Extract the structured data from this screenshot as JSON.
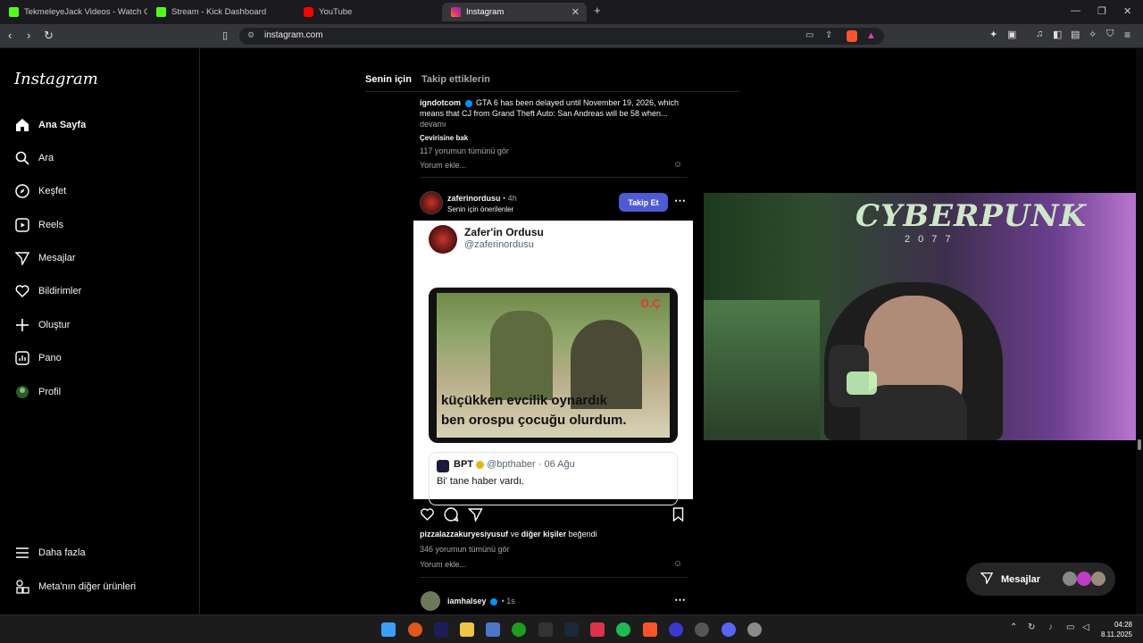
{
  "browser": {
    "tabs": [
      {
        "label": "TekmeleyeJack Videos - Watch On-D",
        "color": "#53fc18"
      },
      {
        "label": "Stream - Kick Dashboard",
        "color": "#53fc18"
      },
      {
        "label": "YouTube",
        "color": "#ff0000"
      },
      {
        "label": "Instagram",
        "color": "#e1306c"
      }
    ],
    "new_tab": "+",
    "url": "instagram.com"
  },
  "sidebar": {
    "logo": "Instagram",
    "items": [
      {
        "label": "Ana Sayfa",
        "icon": "home-icon"
      },
      {
        "label": "Ara",
        "icon": "search-icon"
      },
      {
        "label": "Keşfet",
        "icon": "compass-icon"
      },
      {
        "label": "Reels",
        "icon": "reels-icon"
      },
      {
        "label": "Mesajlar",
        "icon": "send-icon"
      },
      {
        "label": "Bildirimler",
        "icon": "heart-icon"
      },
      {
        "label": "Oluştur",
        "icon": "plus-icon"
      },
      {
        "label": "Pano",
        "icon": "chart-icon"
      },
      {
        "label": "Profil",
        "icon": "avatar-icon"
      }
    ],
    "more": "Daha fazla",
    "meta": "Meta'nın diğer ürünleri"
  },
  "feed": {
    "tabs": [
      "Senin için",
      "Takip ettiklerin"
    ],
    "prev_post": {
      "username": "igndotcom",
      "caption_line1": "GTA 6 has been delayed until November 19, 2026, which",
      "caption_line2": "means that CJ from Grand Theft Auto: San Andreas will be 58 when...",
      "more": "devamı",
      "translate": "Çevirisine bak",
      "comments": "117 yorumun tümünü gör",
      "add_comment": "Yorum ekle..."
    },
    "post": {
      "username": "zaferinordusu",
      "time": "• 4h",
      "suggested": "Senin için önerilenler",
      "follow": "Takip Et",
      "card_name": "Zafer'in Ordusu",
      "card_handle": "@zaferinordusu",
      "meme_line1": "küçükken evcilik oynardık",
      "meme_line2": "ben orospu çocuğu olurdum.",
      "meme_badge": "D.Ç",
      "quote_name": "BPT",
      "quote_handle": "@bpthaber · 06 Ağu",
      "quote_text": "Bi' tane haber vardı.",
      "likes_user": "pizzalazzakuryesiyusuf",
      "likes_mid": "ve",
      "likes_others": "diğer kişiler",
      "likes_end": "beğendi",
      "comments": "346 yorumun tümünü gör",
      "add_comment": "Yorum ekle..."
    },
    "next_post": {
      "username": "iamhalsey",
      "time": "• 1s"
    }
  },
  "webcam": {
    "title": "CYBERPUNK",
    "subtitle": "2077"
  },
  "messages_pill": "Mesajlar",
  "clock": {
    "time": "04:28",
    "date": "8.11.2025"
  }
}
